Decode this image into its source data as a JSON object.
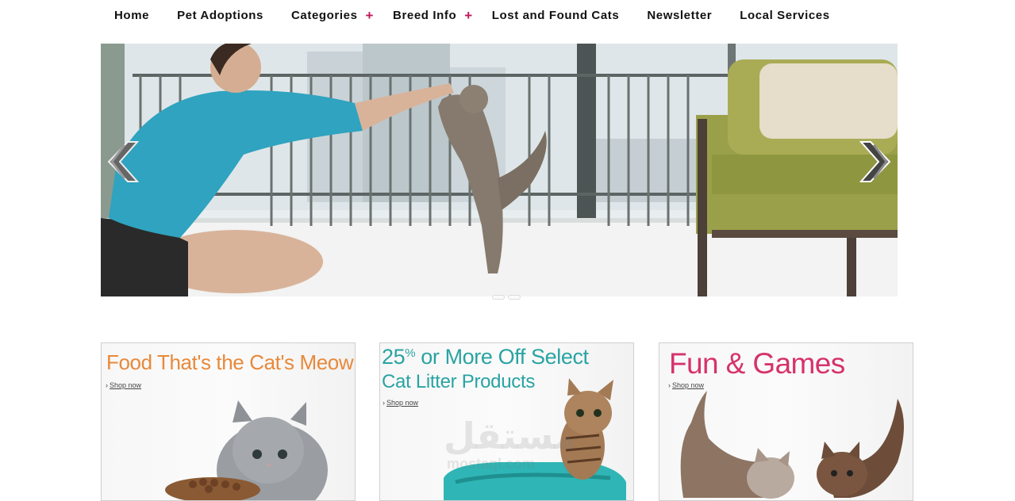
{
  "nav": {
    "items": [
      {
        "label": "Home",
        "has_submenu": false
      },
      {
        "label": "Pet Adoptions",
        "has_submenu": false
      },
      {
        "label": "Categories",
        "has_submenu": true
      },
      {
        "label": "Breed Info",
        "has_submenu": true
      },
      {
        "label": "Lost and Found Cats",
        "has_submenu": false
      },
      {
        "label": "Newsletter",
        "has_submenu": false
      },
      {
        "label": "Local Services",
        "has_submenu": false
      }
    ],
    "submenu_glyph": "+",
    "submenu_color": "#c2185b"
  },
  "slider": {
    "prev_icon": "chevron-left-icon",
    "next_icon": "chevron-right-icon",
    "slide_count": 2,
    "active_index": 0
  },
  "cards": [
    {
      "title": "Food That's the Cat's Meow",
      "title_color": "#e8893a",
      "shop_label": "Shop now"
    },
    {
      "title_number": "25",
      "title_sup": "%",
      "title_rest": " or More Off Select",
      "subtitle": "Cat Litter Products",
      "title_color": "#2aa3a3",
      "shop_label": "Shop now",
      "watermark_arabic": "مستقل",
      "watermark_latin": "mostaql.com"
    },
    {
      "title": "Fun & Games",
      "title_color": "#d6336c",
      "shop_label": "Shop now"
    }
  ]
}
